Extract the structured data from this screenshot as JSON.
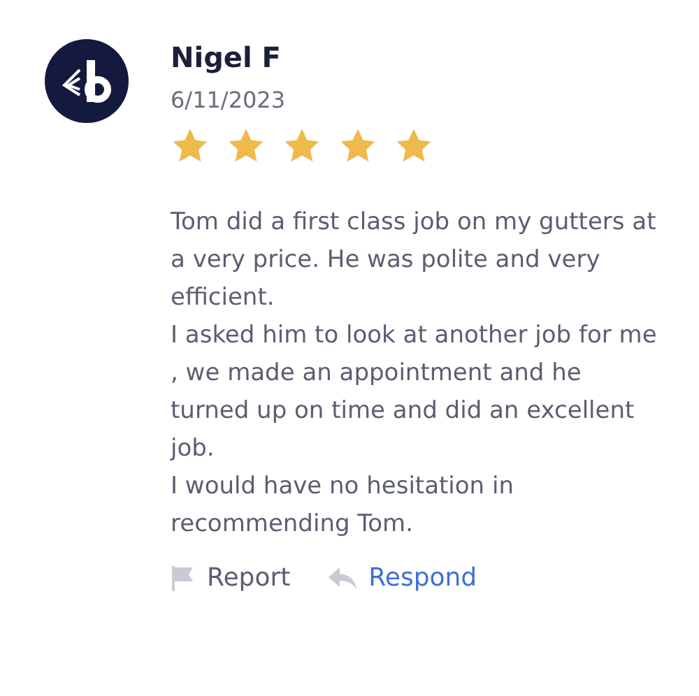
{
  "review": {
    "author": "Nigel F",
    "date": "6/11/2023",
    "stars": 5,
    "text": "Tom did a first class job on my gutters at a very price. He was polite and very efficient.\nI asked him to look at another job for me , we made an appointment and he turned up on time and did an excellent job.\nI would have no hesitation in recommending Tom.",
    "actions": [
      {
        "kind": "report",
        "label": "Report"
      },
      {
        "kind": "respond",
        "label": "Respond"
      }
    ]
  }
}
